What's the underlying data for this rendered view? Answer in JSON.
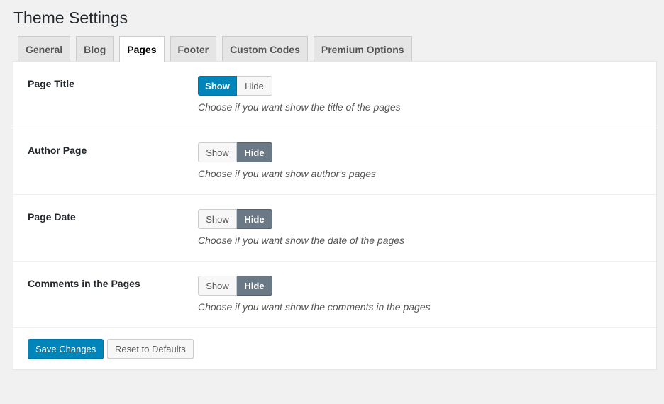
{
  "header": {
    "title": "Theme Settings"
  },
  "tabs": [
    {
      "label": "General",
      "active": false
    },
    {
      "label": "Blog",
      "active": false
    },
    {
      "label": "Pages",
      "active": true
    },
    {
      "label": "Footer",
      "active": false
    },
    {
      "label": "Custom Codes",
      "active": false
    },
    {
      "label": "Premium Options",
      "active": false
    }
  ],
  "settings": [
    {
      "label": "Page Title",
      "show_label": "Show",
      "hide_label": "Hide",
      "selected": "Show",
      "description": "Choose if you want show the title of the pages"
    },
    {
      "label": "Author Page",
      "show_label": "Show",
      "hide_label": "Hide",
      "selected": "Hide",
      "description": "Choose if you want show author's pages"
    },
    {
      "label": "Page Date",
      "show_label": "Show",
      "hide_label": "Hide",
      "selected": "Hide",
      "description": "Choose if you want show the date of the pages"
    },
    {
      "label": "Comments in the Pages",
      "show_label": "Show",
      "hide_label": "Hide",
      "selected": "Hide",
      "description": "Choose if you want show the comments in the pages"
    }
  ],
  "actions": {
    "save_label": "Save Changes",
    "reset_label": "Reset to Defaults"
  },
  "colors": {
    "primary": "#0085ba",
    "selected_hide": "#6b7886",
    "background": "#f1f1f1"
  }
}
